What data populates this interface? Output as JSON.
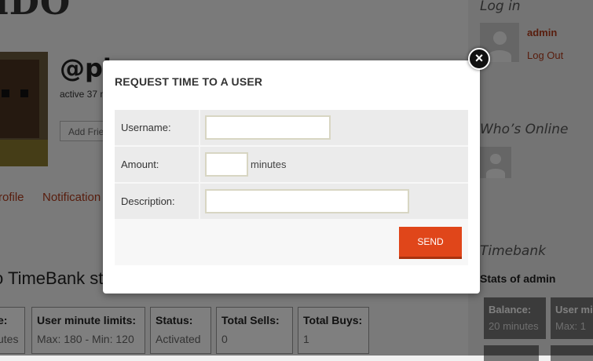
{
  "page": {
    "site_title": "iDO",
    "handle": "@pi",
    "active": "active 37 m",
    "add_friend": "Add Frie",
    "nav": {
      "profile": "rofile",
      "notifications": "Notification"
    },
    "stats_heading": "o TimeBank st",
    "stats": [
      {
        "title": "e:",
        "value": "utes"
      },
      {
        "title": "User minute limits:",
        "value": "Max: 180 - Min: 120"
      },
      {
        "title": "Status:",
        "value": "Activated"
      },
      {
        "title": "Total Sells:",
        "value": "0"
      },
      {
        "title": "Total Buys:",
        "value": "1"
      }
    ]
  },
  "sidebar": {
    "login_heading": "Log in",
    "username": "admin",
    "logout": "Log Out",
    "whos_online_heading": "Who’s Online",
    "timebank_heading": "Timebank",
    "stats_of": "Stats of admin",
    "boxes": [
      {
        "title": "Balance:",
        "value": "20 minutes"
      },
      {
        "title": "User mi",
        "value": "Max: 1"
      }
    ]
  },
  "modal": {
    "title": "REQUEST TIME TO A USER",
    "close_symbol": "×",
    "fields": {
      "username": {
        "label": "Username:",
        "value": "",
        "placeholder": ""
      },
      "amount": {
        "label": "Amount:",
        "value": "",
        "placeholder": "",
        "unit": "minutes"
      },
      "description": {
        "label": "Description:",
        "value": "",
        "placeholder": ""
      }
    },
    "send_label": "SEND"
  },
  "colors": {
    "accent": "#e0461a",
    "link": "#b03a1a",
    "overlay": "rgba(0,0,0,0.5)"
  }
}
